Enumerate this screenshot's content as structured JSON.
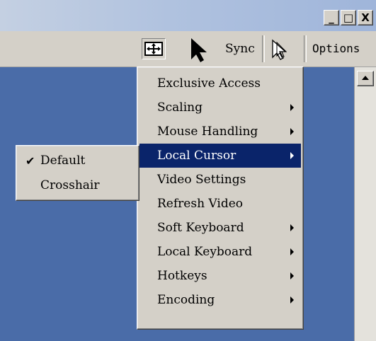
{
  "window": {
    "controls": {
      "minimize_glyph": "_",
      "maximize_glyph": "□",
      "close_glyph": "X"
    }
  },
  "toolbar": {
    "fit_icon": "fit-window-icon",
    "cursor_icon": "arrow-cursor-icon",
    "sync_label": "Sync",
    "outline_cursor_icon": "outline-cursor-icon",
    "options_label": "Options"
  },
  "options_menu": {
    "items": [
      {
        "label": "Exclusive Access",
        "has_submenu": false,
        "highlighted": false
      },
      {
        "label": "Scaling",
        "has_submenu": true,
        "highlighted": false
      },
      {
        "label": "Mouse Handling",
        "has_submenu": true,
        "highlighted": false
      },
      {
        "label": "Local Cursor",
        "has_submenu": true,
        "highlighted": true
      },
      {
        "label": "Video Settings",
        "has_submenu": false,
        "highlighted": false
      },
      {
        "label": "Refresh Video",
        "has_submenu": false,
        "highlighted": false
      },
      {
        "label": "Soft Keyboard",
        "has_submenu": true,
        "highlighted": false
      },
      {
        "label": "Local Keyboard",
        "has_submenu": true,
        "highlighted": false
      },
      {
        "label": "Hotkeys",
        "has_submenu": true,
        "highlighted": false
      },
      {
        "label": "Encoding",
        "has_submenu": true,
        "highlighted": false
      }
    ]
  },
  "local_cursor_submenu": {
    "items": [
      {
        "label": "Default",
        "checked": true,
        "check_glyph": "✔"
      },
      {
        "label": "Crosshair",
        "checked": false
      }
    ]
  },
  "colors": {
    "desktop": "#4a6ca8",
    "menu_highlight": "#0a246a",
    "menu_background": "#d4d0c8"
  }
}
